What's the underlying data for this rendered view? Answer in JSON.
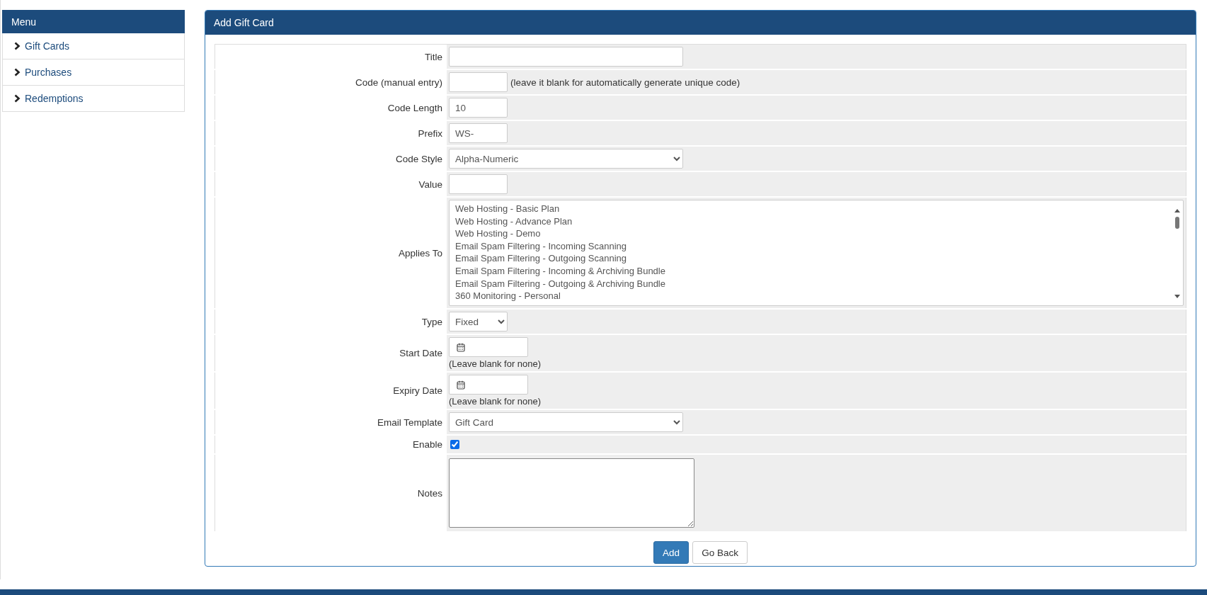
{
  "sidebar": {
    "title": "Menu",
    "items": [
      {
        "label": "Gift Cards"
      },
      {
        "label": "Purchases"
      },
      {
        "label": "Redemptions"
      }
    ]
  },
  "panel": {
    "title": "Add Gift Card",
    "fields": [
      {
        "kind": "longtext",
        "label": "Title"
      },
      {
        "kind": "shorttext",
        "label": "Code (manual entry)",
        "hint": "(leave it blank for automatically generate unique code)"
      },
      {
        "kind": "shorttext",
        "label": "Code Length",
        "value": "10"
      },
      {
        "kind": "shorttext",
        "label": "Prefix",
        "value": "WS-"
      },
      {
        "kind": "longselect",
        "label": "Code Style",
        "value": "Alpha-Numeric"
      },
      {
        "kind": "shorttext",
        "label": "Value"
      },
      {
        "kind": "listbox",
        "label": "Applies To",
        "options": [
          {
            "label": "Web Hosting - Basic Plan",
            "selected": false
          },
          {
            "label": "Web Hosting - Advance Plan",
            "selected": false
          },
          {
            "label": "Web Hosting - Demo",
            "selected": false
          },
          {
            "label": "Email Spam Filtering - Incoming Scanning",
            "selected": false
          },
          {
            "label": "Email Spam Filtering - Outgoing Scanning",
            "selected": false
          },
          {
            "label": "Email Spam Filtering - Incoming & Archiving Bundle",
            "selected": false
          },
          {
            "label": "Email Spam Filtering - Outgoing & Archiving Bundle",
            "selected": false
          },
          {
            "label": "360 Monitoring - Personal",
            "selected": false
          }
        ]
      },
      {
        "kind": "shortselect",
        "label": "Type",
        "value": "Fixed"
      },
      {
        "kind": "date",
        "label": "Start Date",
        "note": "(Leave blank for none)"
      },
      {
        "kind": "date",
        "label": "Expiry Date",
        "note": "(Leave blank for none)"
      },
      {
        "kind": "longselect",
        "label": "Email Template",
        "value": "Gift Card"
      },
      {
        "kind": "checkbox",
        "label": "Enable",
        "checked": true
      },
      {
        "kind": "textarea",
        "label": "Notes"
      }
    ],
    "buttons": [
      {
        "label": "Add",
        "kind": "primary"
      },
      {
        "label": "Go Back",
        "kind": "default"
      }
    ]
  }
}
